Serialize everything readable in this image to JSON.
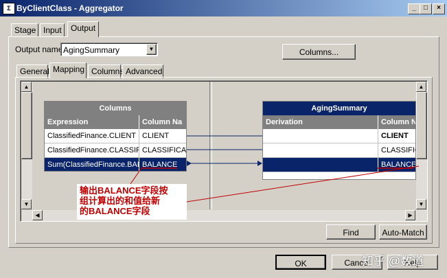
{
  "window": {
    "title": "ByClientClass - Aggregator",
    "app_icon": "aggregator-stage-icon",
    "controls": [
      "_",
      "□",
      "×"
    ]
  },
  "top_tabs": [
    "Stage",
    "Input",
    "Output"
  ],
  "output": {
    "name_label": "Output name:",
    "name_value": "AgingSummary",
    "columns_button": "Columns..."
  },
  "sub_tabs": [
    "General",
    "Mapping",
    "Columns",
    "Advanced"
  ],
  "left_grid": {
    "title": "Columns",
    "headers": [
      "Expression",
      "Column Na"
    ],
    "rows": [
      {
        "expression": "ClassifiedFinance.CLIENT",
        "column": "CLIENT"
      },
      {
        "expression": "ClassifiedFinance.CLASSIFI",
        "column": "CLASSIFICAT"
      },
      {
        "expression": "Sum(ClassifiedFinance.BAL",
        "column": "BALANCE"
      }
    ]
  },
  "right_grid": {
    "title": "AgingSummary",
    "headers": [
      "Derivation",
      "Column N"
    ],
    "rows": [
      {
        "derivation": "",
        "column": "CLIENT"
      },
      {
        "derivation": "",
        "column": "CLASSIFIC"
      },
      {
        "derivation": "",
        "column": "BALANCE"
      }
    ]
  },
  "annotation": [
    "输出BALANCE字段按",
    "组计算出的和值给新",
    "的BALANCE字段"
  ],
  "buttons": {
    "find": "Find",
    "auto_match": "Auto-Match",
    "ok": "OK",
    "cancel": "Cancel",
    "help": "Help"
  },
  "watermark": "知乎 @数道",
  "colors": {
    "title_start": "#0a246a",
    "title_end": "#a6caf0",
    "grid_header_left": "#808080",
    "grid_header_right": "#0a246a",
    "selection": "#0a246a",
    "annotation": "#c00000"
  }
}
